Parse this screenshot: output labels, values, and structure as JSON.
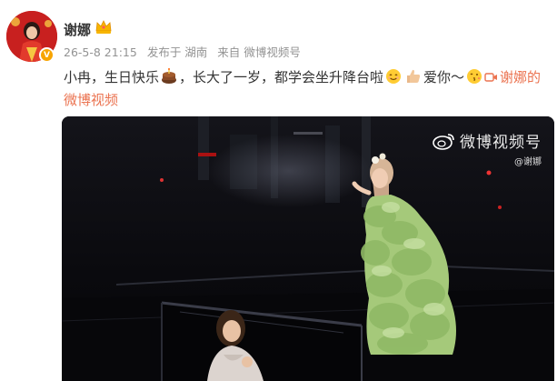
{
  "author": {
    "name": "谢娜",
    "avatar_icon": "avatar-portrait",
    "verified_icon": "verified-badge-icon",
    "crown_icon": "crown-icon"
  },
  "meta": {
    "timestamp": "26-5-8 21:15",
    "location": "发布于 湖南",
    "source_prefix": "来自",
    "source": "微博视频号"
  },
  "post": {
    "text_1": "小冉，生日快乐",
    "text_2": "，长大了一岁，都学会坐升降台啦",
    "text_3": "爱你～",
    "video_link": "谢娜的微博视频",
    "emoji": [
      "cake-emoji",
      "smile-emoji",
      "thumbs-up-emoji",
      "kiss-emoji"
    ]
  },
  "video": {
    "watermark_text": "微博视频号",
    "watermark_handle": "@谢娜",
    "accent": "#eb7350"
  }
}
